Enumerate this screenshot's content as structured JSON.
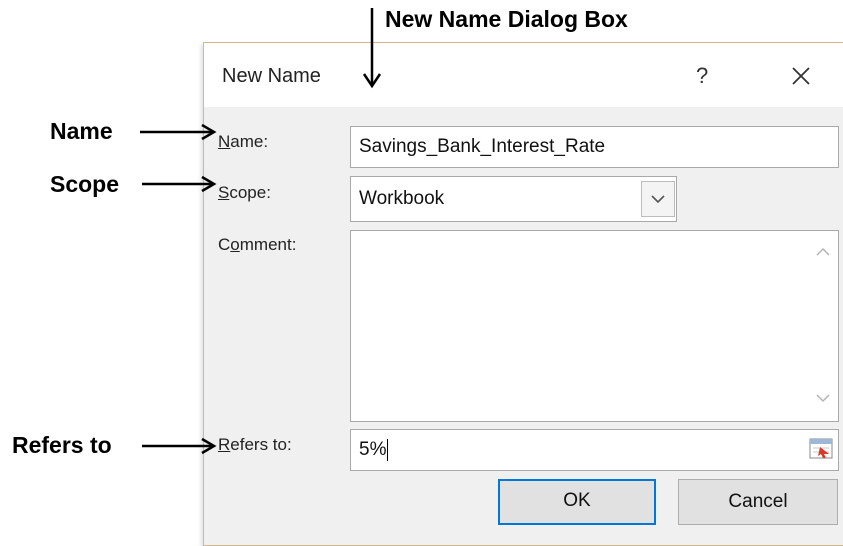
{
  "annotations": {
    "dialog": "New Name Dialog Box",
    "name": "Name",
    "scope": "Scope",
    "refers_to": "Refers to"
  },
  "dialog": {
    "title": "New Name",
    "help_glyph": "?",
    "close_icon": "close-icon",
    "labels": {
      "name_first": "N",
      "name_rest": "ame:",
      "scope_first": "S",
      "scope_rest": "cope:",
      "comment_pre": "C",
      "comment_under": "o",
      "comment_rest": "mment:",
      "refers_first": "R",
      "refers_rest": "efers to:"
    },
    "name_value": "Savings_Bank_Interest_Rate",
    "scope_value": "Workbook",
    "comment_value": "",
    "refers_value": "5%",
    "ok_label": "OK",
    "cancel_label": "Cancel"
  },
  "colors": {
    "ok_border": "#0078d7",
    "dialog_bg": "#f0f0f0",
    "dialog_border": "#d4b88a"
  }
}
